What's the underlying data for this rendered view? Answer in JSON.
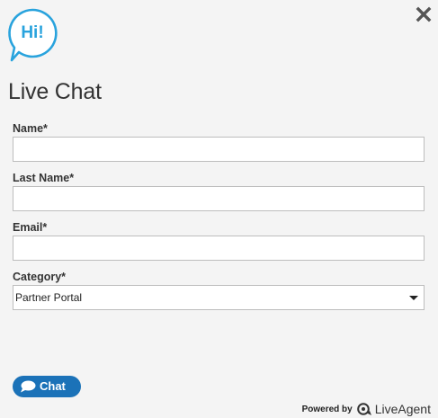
{
  "header": {
    "greeting": "Hi!",
    "title": "Live Chat"
  },
  "form": {
    "name_label": "Name*",
    "name_value": "",
    "last_name_label": "Last Name*",
    "last_name_value": "",
    "email_label": "Email*",
    "email_value": "",
    "category_label": "Category*",
    "category_selected": "Partner Portal"
  },
  "actions": {
    "chat_label": "Chat"
  },
  "footer": {
    "powered_by": "Powered by",
    "brand": "LiveAgent"
  },
  "icons": {
    "close": "close-icon",
    "greeting_bubble": "speech-bubble-icon",
    "chat_bubble": "chat-bubble-icon",
    "brand_logo": "liveagent-logo-icon"
  },
  "colors": {
    "accent": "#29a3dd",
    "button": "#1b72b8",
    "background": "#f4f4f4",
    "close": "#555555"
  }
}
